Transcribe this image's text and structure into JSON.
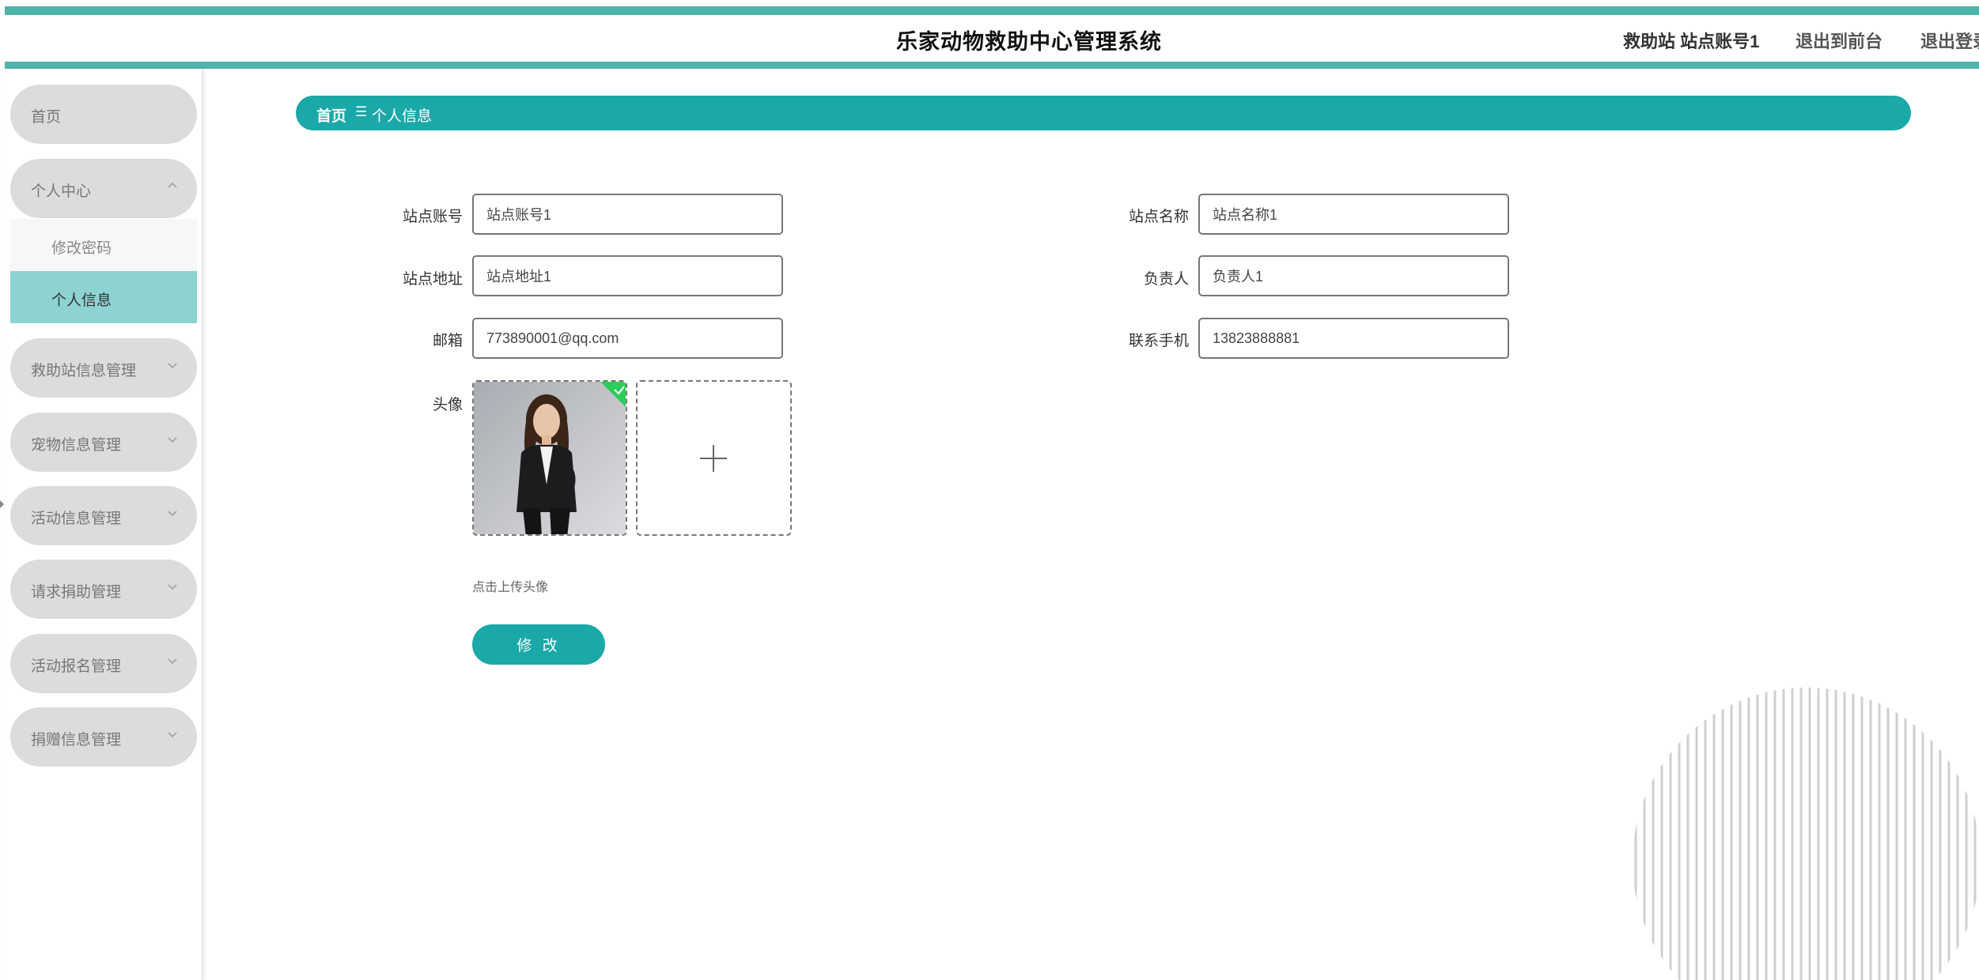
{
  "header": {
    "title": "乐家动物救助中心管理系统",
    "user_role": "救助站",
    "user_name": "站点账号1",
    "links": [
      "退出到前台",
      "退出登录"
    ],
    "accent_color": "#4fb4ac"
  },
  "sidebar": {
    "items": [
      {
        "label": "首页"
      },
      {
        "label": "个人中心",
        "expanded": true,
        "children": [
          {
            "label": "修改密码"
          },
          {
            "label": "个人信息",
            "active": true
          }
        ]
      },
      {
        "label": "救助站信息管理"
      },
      {
        "label": "宠物信息管理"
      },
      {
        "label": "活动信息管理"
      },
      {
        "label": "请求捐助管理"
      },
      {
        "label": "活动报名管理"
      },
      {
        "label": "捐赠信息管理"
      }
    ],
    "active_color": "#8dd3d1"
  },
  "breadcrumb": {
    "home": "首页",
    "separator_icon": "menu-icon",
    "current": "个人信息"
  },
  "form": {
    "fields": [
      {
        "label": "站点账号",
        "value": "站点账号1"
      },
      {
        "label": "站点名称",
        "value": "站点名称1"
      },
      {
        "label": "站点地址",
        "value": "站点地址1"
      },
      {
        "label": "负责人",
        "value": "负责人1"
      },
      {
        "label": "邮箱",
        "value": "773890001@qq.com"
      },
      {
        "label": "联系手机",
        "value": "13823888881"
      }
    ],
    "avatar_label": "头像",
    "upload_hint": "点击上传头像",
    "submit_label": "修 改",
    "primary_color": "#1aa8a8"
  }
}
